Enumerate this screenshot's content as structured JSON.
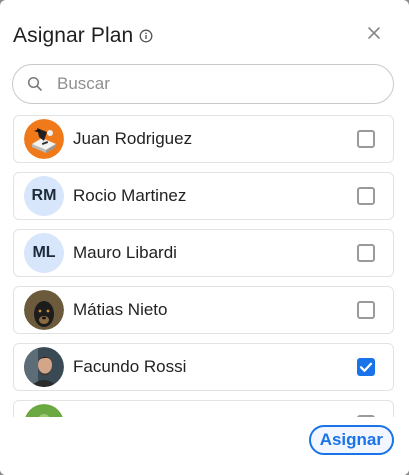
{
  "modal": {
    "title": "Asignar Plan",
    "icons": {
      "info": "info-icon",
      "close": "close-icon",
      "search": "search-icon"
    }
  },
  "search": {
    "placeholder": "Buscar",
    "value": ""
  },
  "users": [
    {
      "name": "Juan Rodriguez",
      "avatar": "photo",
      "checked": false
    },
    {
      "name": "Rocio Martinez",
      "avatar": "RM",
      "checked": false
    },
    {
      "name": "Mauro Libardi",
      "avatar": "ML",
      "checked": false
    },
    {
      "name": "Mátias Nieto",
      "avatar": "photo",
      "checked": false
    },
    {
      "name": "Facundo Rossi",
      "avatar": "photo",
      "checked": true
    },
    {
      "name": "",
      "avatar": "photo",
      "checked": false
    }
  ],
  "footer": {
    "assign_label": "Asignar"
  },
  "colors": {
    "accent": "#1a73e8",
    "initials_bg": "#d7e6fb"
  }
}
